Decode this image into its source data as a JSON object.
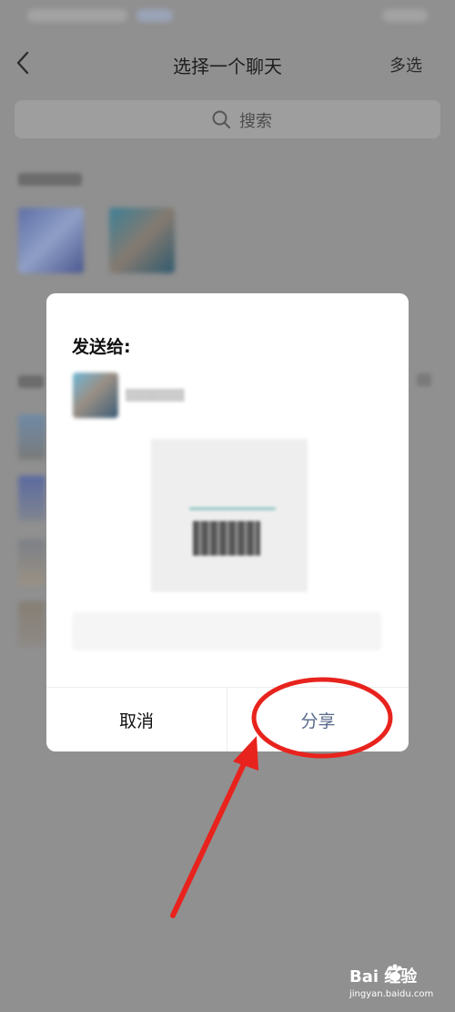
{
  "nav": {
    "title": "选择一个聊天",
    "multi_select": "多选"
  },
  "search": {
    "placeholder": "搜索"
  },
  "dialog": {
    "title": "发送给:",
    "cancel_label": "取消",
    "share_label": "分享"
  },
  "watermark": {
    "logo_text": "Bai  经验",
    "site": "jingyan.baidu.com"
  },
  "colors": {
    "dim_background": "#909090",
    "dialog_bg": "#ffffff",
    "share_text": "#5a6a8c",
    "annotation_red": "#e8231d"
  }
}
